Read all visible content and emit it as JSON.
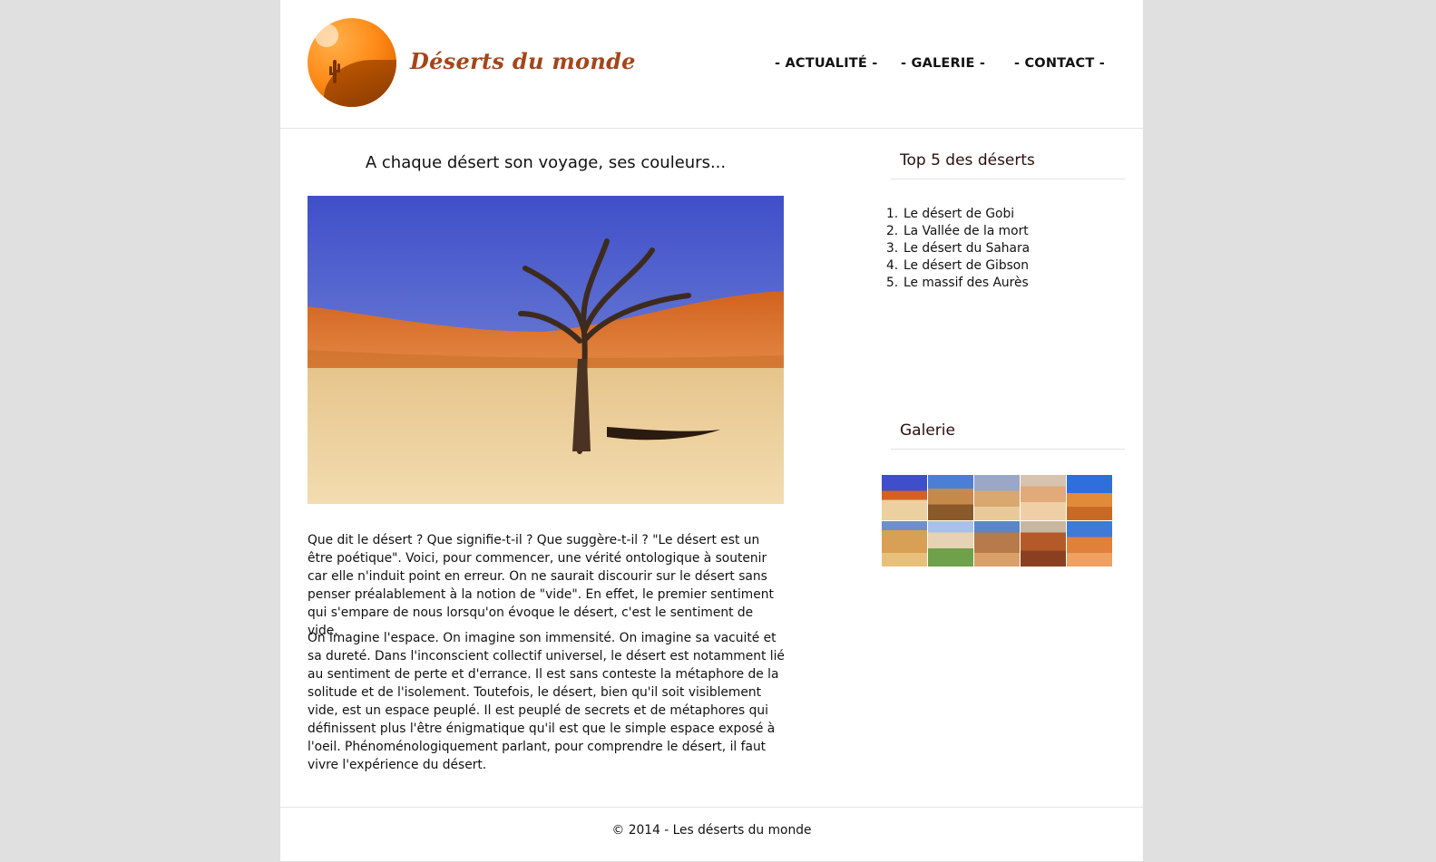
{
  "site": {
    "title": "Déserts du monde"
  },
  "nav": [
    {
      "label": "- ACTUALITÉ -"
    },
    {
      "label": "- GALERIE -"
    },
    {
      "label": "- CONTACT -"
    }
  ],
  "main": {
    "heading": "A chaque désert son voyage, ses couleurs...",
    "paragraphs": [
      "Que dit le désert ? Que signifie-t-il ? Que suggère-t-il ? \"Le désert est un être poétique\". Voici, pour commencer, une vérité ontologique à soutenir car elle n'induit point en erreur. On ne saurait discourir sur le désert sans penser préalablement à la notion de \"vide\". En effet, le premier sentiment qui s'empare de nous lorsqu'on évoque le désert, c'est le sentiment de vide.",
      "On imagine l'espace. On imagine son immensité. On imagine sa vacuité et sa dureté. Dans l'inconscient collectif universel, le désert est notamment lié au sentiment de perte et d'errance. Il est sans conteste la métaphore de la solitude et de l'isolement. Toutefois, le désert, bien qu'il soit visiblement vide, est un espace peuplé. Il est peuplé de secrets et de métaphores qui définissent plus l'être énigmatique qu'il est que le simple espace exposé à l'oeil. Phénoménologiquement parlant, pour comprendre le désert, il faut vivre l'expérience du désert."
    ]
  },
  "sidebar": {
    "top5_title": "Top 5 des déserts",
    "top5": [
      {
        "num": "1.",
        "label": "Le désert de Gobi"
      },
      {
        "num": "2.",
        "label": "La Vallée de la mort"
      },
      {
        "num": "3.",
        "label": "Le désert du Sahara"
      },
      {
        "num": "4.",
        "label": "Le désert de Gibson"
      },
      {
        "num": "5.",
        "label": "Le massif des Aurès"
      }
    ],
    "gallery_title": "Galerie"
  },
  "footer": {
    "text": "© 2014 - Les déserts du monde"
  },
  "colors": {
    "title": "#a3461a",
    "logo": "#ff8c1a",
    "background": "#e0e0e0"
  }
}
